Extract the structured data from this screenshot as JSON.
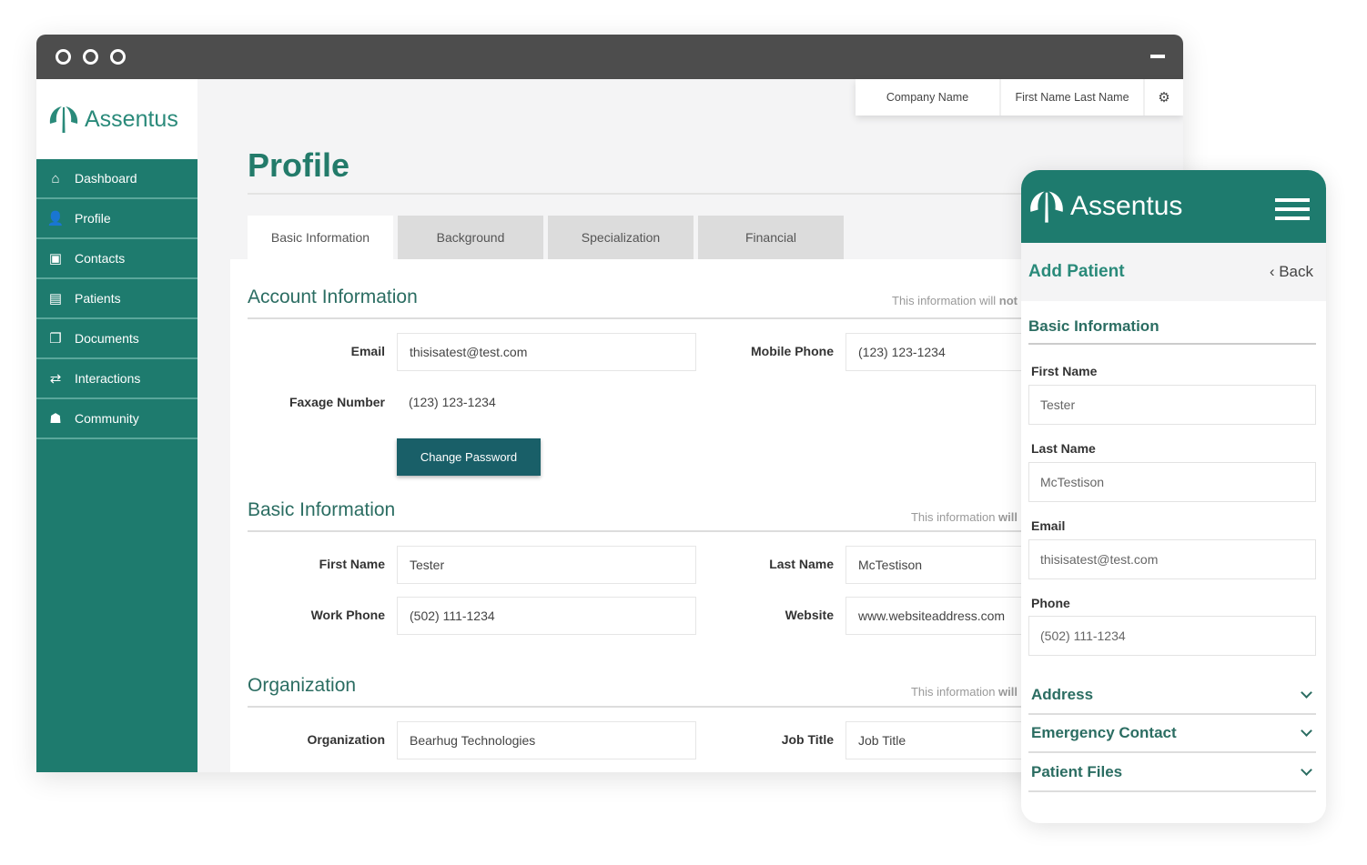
{
  "brand": {
    "name": "Assentus",
    "color": "#1e7b6e"
  },
  "topbar": {
    "company": "Company Name",
    "user": "First Name Last Name",
    "settings_icon": "gear-icon"
  },
  "sidebar": {
    "items": [
      {
        "label": "Dashboard",
        "icon": "home-icon"
      },
      {
        "label": "Profile",
        "icon": "user-icon"
      },
      {
        "label": "Contacts",
        "icon": "address-book-icon"
      },
      {
        "label": "Patients",
        "icon": "patient-file-icon"
      },
      {
        "label": "Documents",
        "icon": "documents-icon"
      },
      {
        "label": "Interactions",
        "icon": "exchange-icon"
      },
      {
        "label": "Community",
        "icon": "group-icon"
      }
    ]
  },
  "page": {
    "title": "Profile",
    "tabs": [
      "Basic Information",
      "Background",
      "Specialization",
      "Financial"
    ],
    "account": {
      "title": "Account Information",
      "note_pre": "This information will ",
      "note_bold": "not",
      "email_label": "Email",
      "email": "thisisatest@test.com",
      "mobile_label": "Mobile Phone",
      "mobile": "(123) 123-1234",
      "fax_label": "Faxage Number",
      "fax": "(123) 123-1234",
      "change_password": "Change Password"
    },
    "basic": {
      "title": "Basic Information",
      "note_pre": "This information ",
      "note_bold": "will",
      "first_label": "First Name",
      "first": "Tester",
      "last_label": "Last Name",
      "last": "McTestison",
      "work_label": "Work Phone",
      "work": "(502) 111-1234",
      "website_label": "Website",
      "website": "www.websiteaddress.com"
    },
    "org": {
      "title": "Organization",
      "note_pre": "This information ",
      "note_bold": "will",
      "org_label": "Organization",
      "org": "Bearhug Technologies",
      "job_label": "Job Title",
      "job": "Job Title"
    }
  },
  "mobile": {
    "title": "Add Patient",
    "back": "Back",
    "section": "Basic Information",
    "first_label": "First Name",
    "first": "Tester",
    "last_label": "Last Name",
    "last": "McTestison",
    "email_label": "Email",
    "email": "thisisatest@test.com",
    "phone_label": "Phone",
    "phone": "(502) 111-1234",
    "accordions": [
      "Address",
      "Emergency Contact",
      "Patient Files"
    ]
  }
}
